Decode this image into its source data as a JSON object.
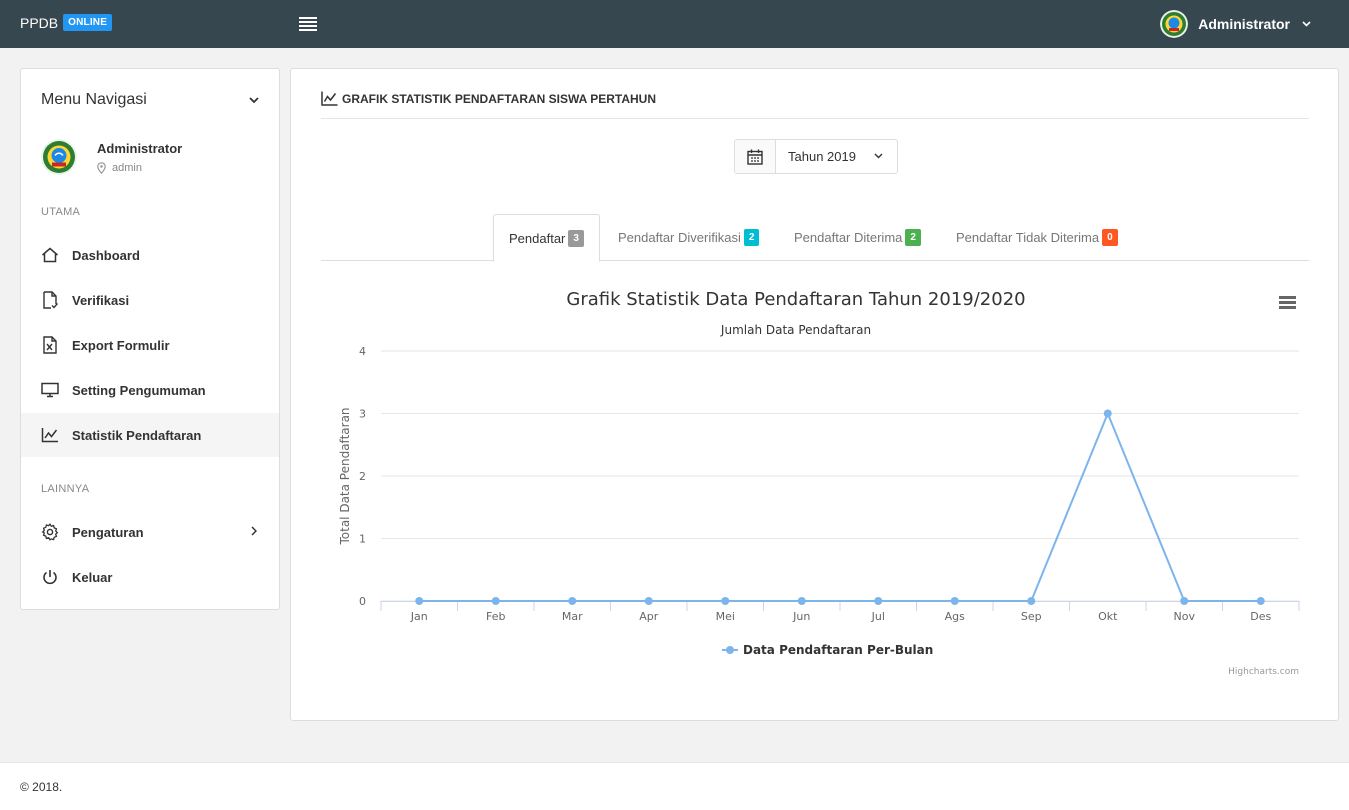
{
  "app": {
    "brand": "PPDB",
    "brand_badge": "ONLINE"
  },
  "topbar": {
    "user_name": "Administrator"
  },
  "sidebar": {
    "title": "Menu Navigasi",
    "user": {
      "name": "Administrator",
      "role": "admin"
    },
    "section_main": "UTAMA",
    "items": [
      {
        "label": "Dashboard",
        "icon": "home-icon"
      },
      {
        "label": "Verifikasi",
        "icon": "file-check-icon"
      },
      {
        "label": "Export Formulir",
        "icon": "excel-file-icon"
      },
      {
        "label": "Setting Pengumuman",
        "icon": "monitor-icon"
      },
      {
        "label": "Statistik Pendaftaran",
        "icon": "line-chart-icon",
        "active": true
      }
    ],
    "section_other": "LAINNYA",
    "other_items": [
      {
        "label": "Pengaturan",
        "icon": "gear-icon"
      },
      {
        "label": "Keluar",
        "icon": "power-icon"
      }
    ]
  },
  "panel": {
    "title": "GRAFIK STATISTIK PENDAFTARAN SISWA PERTAHUN",
    "year_select": "Tahun 2019",
    "tabs": [
      {
        "label": "Pendaftar",
        "count": "3",
        "color": "#999999",
        "active": true
      },
      {
        "label": "Pendaftar Diverifikasi",
        "count": "2",
        "color": "#00bcd4"
      },
      {
        "label": "Pendaftar Diterima",
        "count": "2",
        "color": "#4caf50"
      },
      {
        "label": "Pendaftar Tidak Diterima",
        "count": "0",
        "color": "#ff5722"
      }
    ]
  },
  "chart_data": {
    "type": "line",
    "title": "Grafik Statistik Data Pendaftaran Tahun 2019/2020",
    "subtitle": "Jumlah Data Pendaftaran",
    "ylabel": "Total Data Pendaftaran",
    "xlabel": "",
    "categories": [
      "Jan",
      "Feb",
      "Mar",
      "Apr",
      "Mei",
      "Jun",
      "Jul",
      "Ags",
      "Sep",
      "Okt",
      "Nov",
      "Des"
    ],
    "series": [
      {
        "name": "Data Pendaftaran Per-Bulan",
        "values": [
          0,
          0,
          0,
          0,
          0,
          0,
          0,
          0,
          0,
          3,
          0,
          0
        ],
        "color": "#7cb5ec"
      }
    ],
    "ylim": [
      0,
      4
    ],
    "yticks": [
      0,
      1,
      2,
      3,
      4
    ],
    "grid": true,
    "legend": "bottom-center",
    "credits": "Highcharts.com"
  },
  "footer": {
    "text": "© 2018."
  }
}
